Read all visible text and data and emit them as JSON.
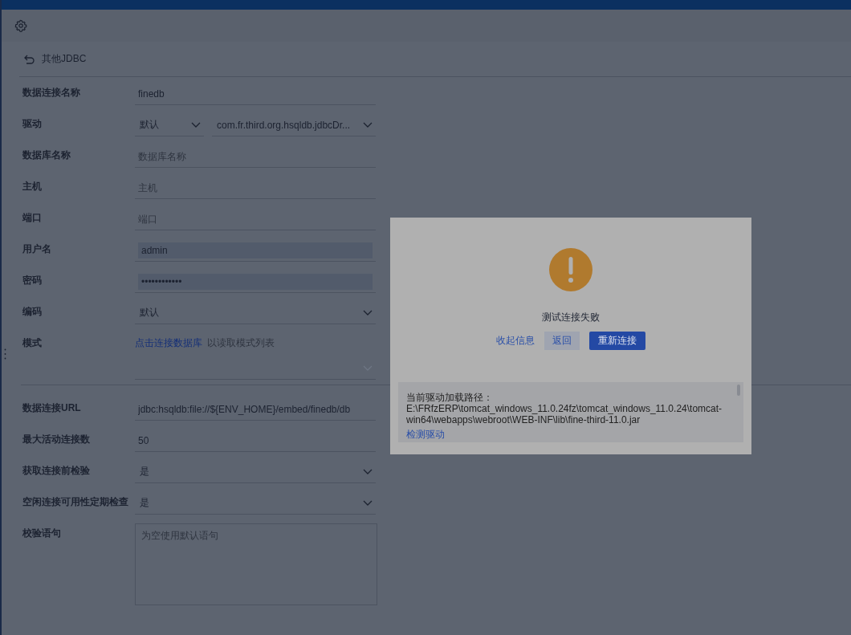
{
  "back": {
    "label": "其他JDBC"
  },
  "sections": [
    {
      "fields": [
        {
          "kind": "text",
          "label": "数据连接名称",
          "value": "finedb"
        },
        {
          "kind": "select_pair",
          "label": "驱动",
          "value": "默认",
          "value_2": "com.fr.third.org.hsqldb.jdbcDr..."
        },
        {
          "kind": "text",
          "label": "数据库名称",
          "placeholder": "数据库名称"
        },
        {
          "kind": "text",
          "label": "主机",
          "placeholder": "主机"
        },
        {
          "kind": "text",
          "label": "端口",
          "placeholder": "端口"
        },
        {
          "kind": "filled",
          "label": "用户名",
          "value": "admin"
        },
        {
          "kind": "filled",
          "label": "密码",
          "value": "••••••••••••"
        },
        {
          "kind": "select",
          "label": "编码",
          "value": "默认"
        },
        {
          "kind": "schema",
          "label": "模式",
          "link": "点击连接数据库",
          "hint": "以读取模式列表"
        }
      ]
    },
    {
      "fields": [
        {
          "kind": "text",
          "label": "数据连接URL",
          "value": "jdbc:hsqldb:file://${ENV_HOME}/embed/finedb/db"
        },
        {
          "kind": "text",
          "label": "最大活动连接数",
          "value": "50"
        },
        {
          "kind": "select",
          "label": "获取连接前检验",
          "value": "是"
        },
        {
          "kind": "select",
          "label": "空闲连接可用性定期检查",
          "value": "是"
        },
        {
          "kind": "textarea",
          "label": "校验语句",
          "placeholder": "为空使用默认语句"
        }
      ]
    }
  ],
  "dialog": {
    "title": "测试连接失败",
    "collapse_link": "收起信息",
    "back_button": "返回",
    "retry_button": "重新连接",
    "detail_label": "当前驱动加载路径：",
    "detail_path": "E:\\FRfzERP\\tomcat_windows_11.0.24fz\\tomcat_windows_11.0.24\\tomcat-win64\\webapps\\webroot\\WEB-INF\\lib\\fine-third-11.0.jar",
    "detect_link": "检测驱动"
  }
}
